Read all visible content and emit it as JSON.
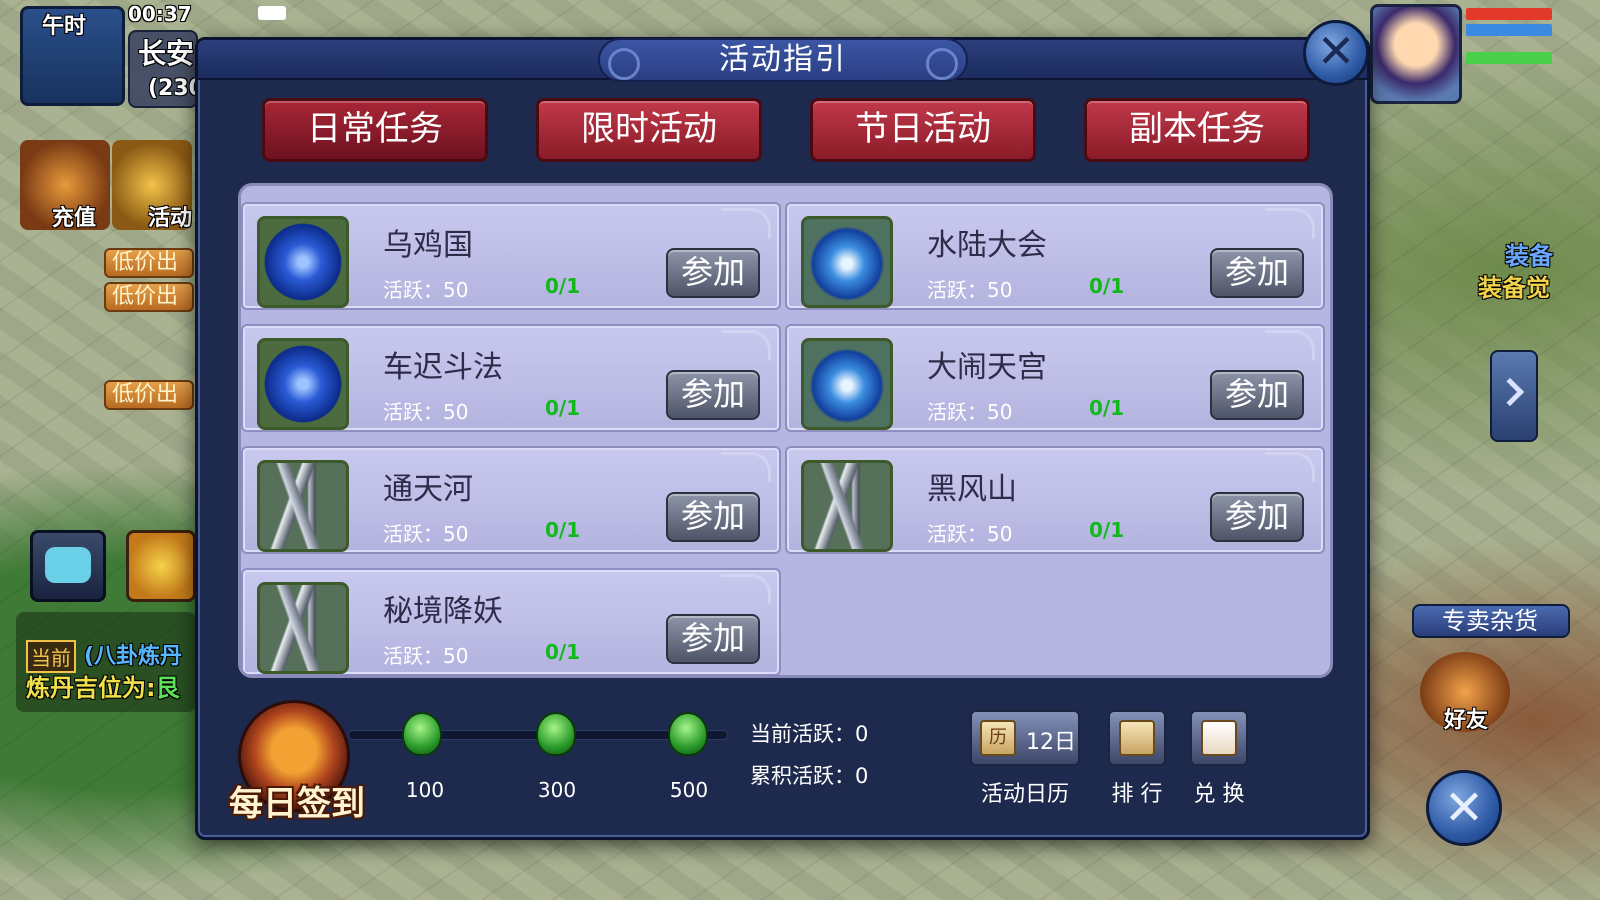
{
  "hud": {
    "time_period": "午时",
    "clock": "00:37",
    "location": "长安",
    "coords": "(230",
    "recharge_label": "充值",
    "activity_label": "活动",
    "left_tags": [
      "低价出",
      "低价出",
      "低价出"
    ],
    "current_tag": "当前",
    "current_info": "(八卦炼丹",
    "alchemy_hint": "炼丹吉位为:",
    "alchemy_value": "艮",
    "shop_label": "专卖杂货",
    "friends_label": "好友",
    "equip_label_1": "装备",
    "equip_label_2": "装备觉"
  },
  "dialog": {
    "title": "活动指引",
    "tabs": [
      "日常任务",
      "限时活动",
      "节日活动",
      "副本任务"
    ],
    "join_label": "参加",
    "activity_prefix": "活跃：",
    "activities": [
      {
        "name": "乌鸡国",
        "active": "50",
        "count": "0/1",
        "icon": "orb-icon"
      },
      {
        "name": "水陆大会",
        "active": "50",
        "count": "0/1",
        "icon": "blue-flame-icon"
      },
      {
        "name": "车迟斗法",
        "active": "50",
        "count": "0/1",
        "icon": "orb-icon"
      },
      {
        "name": "大闹天宫",
        "active": "50",
        "count": "0/1",
        "icon": "blue-flame-icon"
      },
      {
        "name": "通天河",
        "active": "50",
        "count": "0/1",
        "icon": "crystal-icon"
      },
      {
        "name": "黑风山",
        "active": "50",
        "count": "0/1",
        "icon": "crystal-icon"
      },
      {
        "name": "秘境降妖",
        "active": "50",
        "count": "0/1",
        "icon": "crystal-icon"
      }
    ],
    "daily_sign_in": "每日签到",
    "milestones": [
      "100",
      "300",
      "500"
    ],
    "progress_fraction": 0,
    "current_active_label": "当前活跃：",
    "current_active_value": "0",
    "total_active_label": "累积活跃：",
    "total_active_value": "0",
    "calendar_day": "12日",
    "calendar_icon_text": "历",
    "calendar_label": "活动日历",
    "ranking_label": "排 行",
    "exchange_label": "兑 换"
  }
}
